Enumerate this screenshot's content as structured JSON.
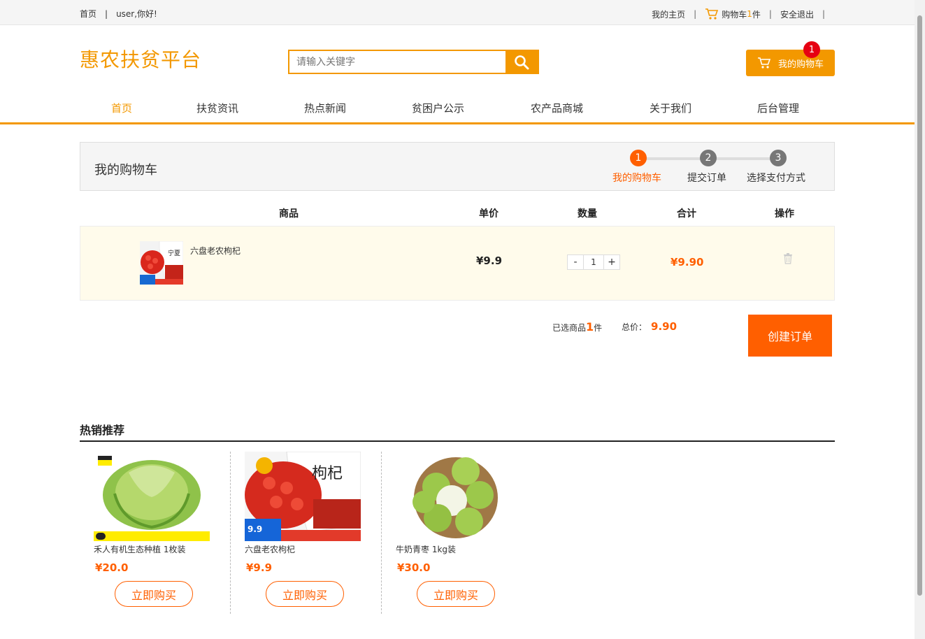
{
  "topbar": {
    "home": "首页",
    "greeting": "user,你好!",
    "my_home": "我的主页",
    "cart_prefix": "购物车",
    "cart_count": "1",
    "cart_suffix": "件",
    "logout": "安全退出"
  },
  "header": {
    "logo": "惠农扶贫平台",
    "search_placeholder": "请输入关键字",
    "cart_button": "我的购物车",
    "cart_badge": "1"
  },
  "nav": {
    "items": [
      "首页",
      "扶贫资讯",
      "热点新闻",
      "贫困户公示",
      "农产品商城",
      "关于我们",
      "后台管理"
    ],
    "active_index": 0
  },
  "cart": {
    "title": "我的购物车",
    "steps": [
      {
        "num": "1",
        "label": "我的购物车"
      },
      {
        "num": "2",
        "label": "提交订单"
      },
      {
        "num": "3",
        "label": "选择支付方式"
      }
    ],
    "columns": {
      "product": "商品",
      "unit_price": "单价",
      "quantity": "数量",
      "subtotal": "合计",
      "action": "操作"
    },
    "items": [
      {
        "name": "六盘老农枸杞",
        "price": "¥9.9",
        "qty_minus": "-",
        "qty": "1",
        "qty_plus": "+",
        "subtotal": "¥9.90"
      }
    ],
    "summary": {
      "selected_prefix": "已选商品",
      "selected_count": "1",
      "selected_suffix": "件",
      "total_label": "总价：",
      "total_value": "9.90"
    },
    "create_order": "创建订单"
  },
  "hot": {
    "title": "热销推荐",
    "products": [
      {
        "name": "禾人有机生态种植 1枚装",
        "price": "¥20.0",
        "buy": "立即购买"
      },
      {
        "name": "六盘老农枸杞",
        "price": "¥9.9",
        "buy": "立即购买"
      },
      {
        "name": "牛奶青枣 1kg装",
        "price": "¥30.0",
        "buy": "立即购买"
      }
    ]
  },
  "colors": {
    "accent": "#f39800",
    "price": "#ff5f00",
    "badge": "#e60012",
    "row_bg": "#fffbeb"
  }
}
